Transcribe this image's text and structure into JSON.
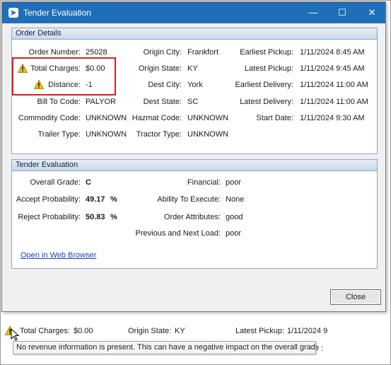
{
  "window": {
    "title": "Tender Evaluation",
    "minimize": "—",
    "maximize": "☐",
    "close": "✕"
  },
  "order_details": {
    "header": "Order Details",
    "col1": [
      {
        "label": "Order Number:",
        "value": "25028"
      },
      {
        "label": "Total Charges:",
        "value": "$0.00",
        "warning": true
      },
      {
        "label": "Distance:",
        "value": "-1",
        "warning": true
      },
      {
        "label": "Bill To Code:",
        "value": "PALYOR"
      },
      {
        "label": "Commodity Code:",
        "value": "UNKNOWN"
      },
      {
        "label": "Trailer Type:",
        "value": "UNKNOWN"
      }
    ],
    "col2": [
      {
        "label": "Origin City:",
        "value": "Frankfort"
      },
      {
        "label": "Origin State:",
        "value": "KY"
      },
      {
        "label": "Dest City:",
        "value": "York"
      },
      {
        "label": "Dest State:",
        "value": "SC"
      },
      {
        "label": "Hazmat Code:",
        "value": "UNKNOWN"
      },
      {
        "label": "Tractor Type:",
        "value": "UNKNOWN"
      }
    ],
    "col3": [
      {
        "label": "Earliest Pickup:",
        "value": "1/11/2024 8:45 AM"
      },
      {
        "label": "Latest Pickup:",
        "value": "1/11/2024 9:45 AM"
      },
      {
        "label": "Earliest Delivery:",
        "value": "1/11/2024 11:00 AM"
      },
      {
        "label": "Latest Delivery:",
        "value": "1/11/2024 11:00 AM"
      },
      {
        "label": "Start Date:",
        "value": "1/11/2024 9:30 AM"
      }
    ]
  },
  "tender_evaluation": {
    "header": "Tender Evaluation",
    "overall_grade": {
      "label": "Overall Grade:",
      "value": "C"
    },
    "accept_probability": {
      "label": "Accept Probability:",
      "value": "49.17",
      "unit": "%"
    },
    "reject_probability": {
      "label": "Reject Probability:",
      "value": "50.83",
      "unit": "%"
    },
    "financial": {
      "label": "Financial:",
      "value": "poor"
    },
    "ability_to_execute": {
      "label": "Ability To Execute:",
      "value": "None"
    },
    "order_attributes": {
      "label": "Order Attributes:",
      "value": "good"
    },
    "previous_next_load": {
      "label": "Previous and Next Load:",
      "value": "poor"
    },
    "web_link": "Open in Web Browser"
  },
  "close_button": "Close",
  "background_row": {
    "total_charges_label": "Total Charges:",
    "total_charges_value": "$0.00",
    "origin_state_label": "Origin State:",
    "origin_state_value": "KY",
    "latest_pickup_label": "Latest Pickup:",
    "latest_pickup_value": "1/11/2024 9",
    "trailing": "# :"
  },
  "tooltip": "No revenue information is present. This can have a negative impact on the overall grade.",
  "colors": {
    "title_bar": "#1f6fb8",
    "highlight_box": "#d81e1e",
    "warning": "#f5c400",
    "link": "#1a3fbf"
  }
}
